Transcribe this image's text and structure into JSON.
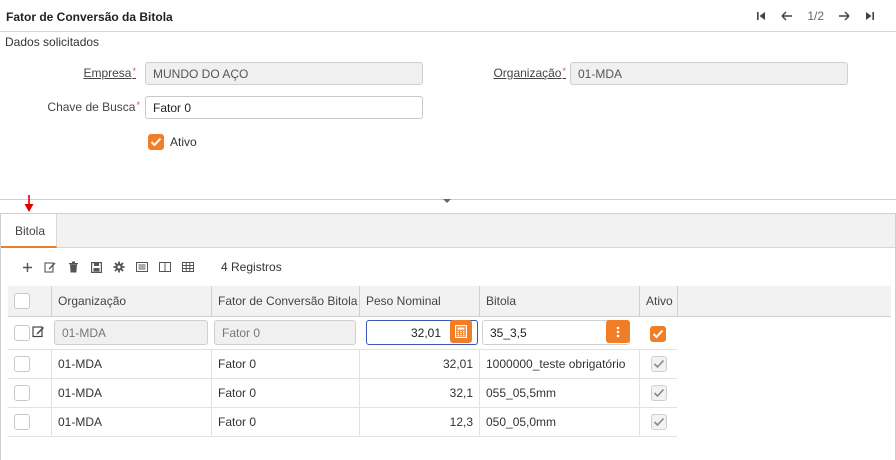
{
  "window": {
    "title": "Fator de Conversão da Bitola",
    "record_position": "1/2"
  },
  "form": {
    "section": "Dados solicitados",
    "empresa": {
      "label": "Empresa",
      "value": "MUNDO DO AÇO"
    },
    "organizacao": {
      "label": "Organização",
      "value": "01-MDA"
    },
    "chave_busca": {
      "label": "Chave de Busca",
      "value": "Fator 0"
    },
    "ativo": {
      "label": "Ativo",
      "checked": true
    },
    "required_mark": "*"
  },
  "tabs": [
    {
      "label": "Bitola",
      "active": true
    }
  ],
  "toolbar": {
    "icons": [
      "plus-icon",
      "edit-icon",
      "trash-icon",
      "save-icon",
      "gear-icon",
      "list-icon",
      "columns-icon",
      "grid-icon"
    ],
    "records_label": "4 Registros"
  },
  "grid": {
    "columns": [
      "Organização",
      "Fator de Conversão Bitola",
      "Peso Nominal",
      "Bitola",
      "Ativo"
    ],
    "edit_row": {
      "organizacao": "01-MDA",
      "fator": "Fator 0",
      "peso": "32,01",
      "bitola": "35_3,5",
      "ativo": true
    },
    "rows": [
      {
        "organizacao": "01-MDA",
        "fator": "Fator 0",
        "peso": "32,01",
        "bitola": "1000000_teste obrigatório",
        "ativo": true
      },
      {
        "organizacao": "01-MDA",
        "fator": "Fator 0",
        "peso": "32,1",
        "bitola": "055_05,5mm",
        "ativo": true
      },
      {
        "organizacao": "01-MDA",
        "fator": "Fator 0",
        "peso": "12,3",
        "bitola": "050_05,0mm",
        "ativo": true
      }
    ]
  },
  "colors": {
    "accent": "#f07e26",
    "focus": "#3c55b8",
    "marker": "#e00000"
  }
}
